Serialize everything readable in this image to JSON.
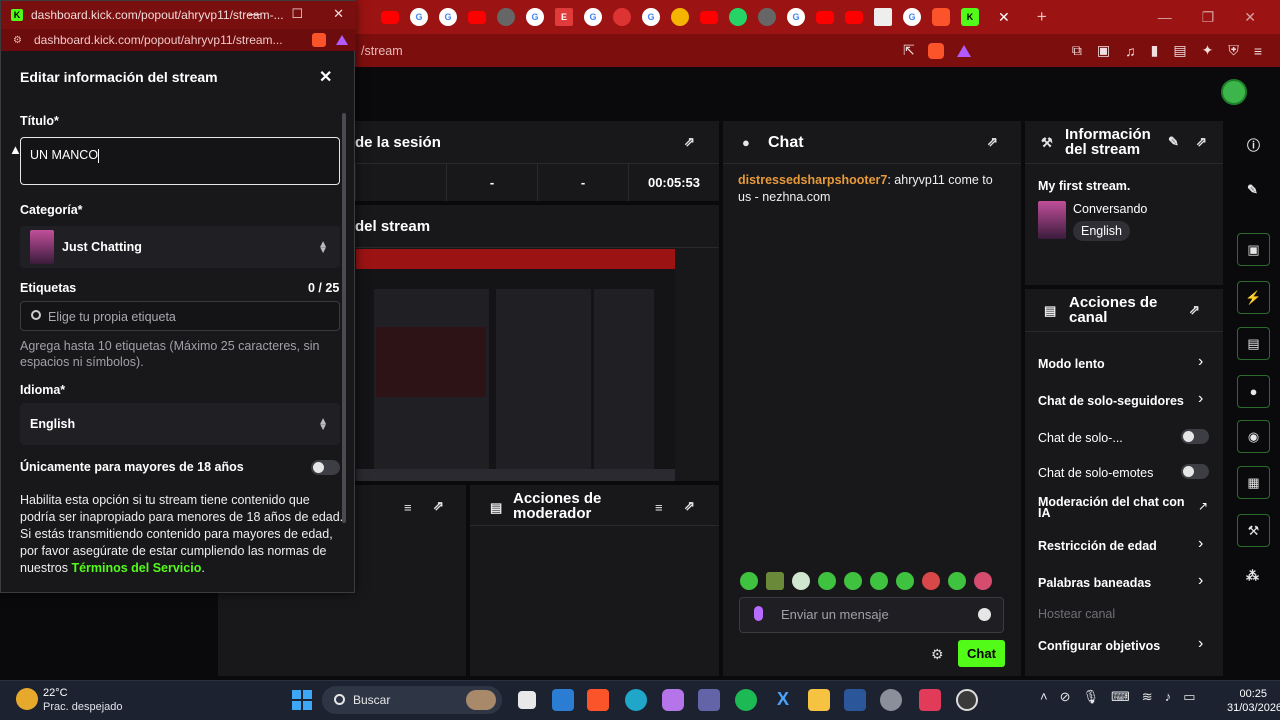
{
  "browser": {
    "address_partial": "/stream",
    "tab_icons": [
      "youtube",
      "google",
      "google",
      "youtube",
      "generic",
      "google",
      "e-icon",
      "google",
      "red-g",
      "google",
      "drive",
      "youtube",
      "whatsapp",
      "generic",
      "google",
      "youtube",
      "youtube",
      "gallery",
      "google",
      "brave",
      "kick"
    ]
  },
  "popup": {
    "window_title": "dashboard.kick.com/popout/ahryvp11/stream-...",
    "url": "dashboard.kick.com/popout/ahryvp11/stream...",
    "heading": "Editar información del stream",
    "title_label": "Título*",
    "title_value": "UN MANCO",
    "category_label": "Categoría*",
    "category_value": "Just Chatting",
    "tags_label": "Etiquetas",
    "tags_count": "0 / 25",
    "tags_placeholder": "Elige tu propia etiqueta",
    "tags_hint": "Agrega hasta 10 etiquetas (Máximo 25 caracteres, sin espacios ni símbolos).",
    "language_label": "Idioma*",
    "language_value": "English",
    "adult_label": "Únicamente para mayores de 18 años",
    "adult_desc": "Habilita esta opción si tu stream tiene contenido que podría ser inapropiado para menores de 18 años de edad. Si estás transmitiendo contenido para mayores de edad, por favor asegúrate de estar cumpliendo las normas de nuestros",
    "tos_link": "Términos del Servicio",
    "tos_end": "."
  },
  "session": {
    "title": "de la sesión",
    "cells": [
      "-",
      "-",
      "00:05:53"
    ],
    "preview_title": "del stream"
  },
  "moderator": {
    "title": "Acciones de moderador"
  },
  "chat": {
    "title": "Chat",
    "username": "distressedsharpshooter7",
    "message": ": ahryvp11 come to us - nezhna.com",
    "placeholder": "Enviar un mensaje",
    "send_label": "Chat"
  },
  "stream_info": {
    "title_line1": "Información",
    "title_line2": "del stream",
    "stream_title": "My first stream.",
    "category": "Conversando",
    "language": "English"
  },
  "channel_actions": {
    "title_line1": "Acciones de",
    "title_line2": "canal",
    "items": [
      {
        "label": "Modo lento",
        "control": "chevron"
      },
      {
        "label": "Chat de solo-seguidores",
        "control": "chevron"
      },
      {
        "label": "Chat de solo-...",
        "control": "toggle"
      },
      {
        "label": "Chat de solo-emotes",
        "control": "toggle"
      },
      {
        "label": "Moderación del chat con IA",
        "control": "external"
      },
      {
        "label": "Restricción de edad",
        "control": "chevron"
      },
      {
        "label": "Palabras baneadas",
        "control": "chevron"
      },
      {
        "label": "Hostear canal",
        "control": "none"
      },
      {
        "label": "Configurar objetivos",
        "control": "chevron"
      }
    ]
  },
  "taskbar": {
    "temp": "22°C",
    "weather": "Prac. despejado",
    "search": "Buscar",
    "time": "00:25",
    "date": "31/03/2026"
  },
  "colors": {
    "accent": "#53fc18",
    "browser_red": "#9b1313",
    "panel": "#18181b",
    "chat_user": "#e89a3a"
  }
}
